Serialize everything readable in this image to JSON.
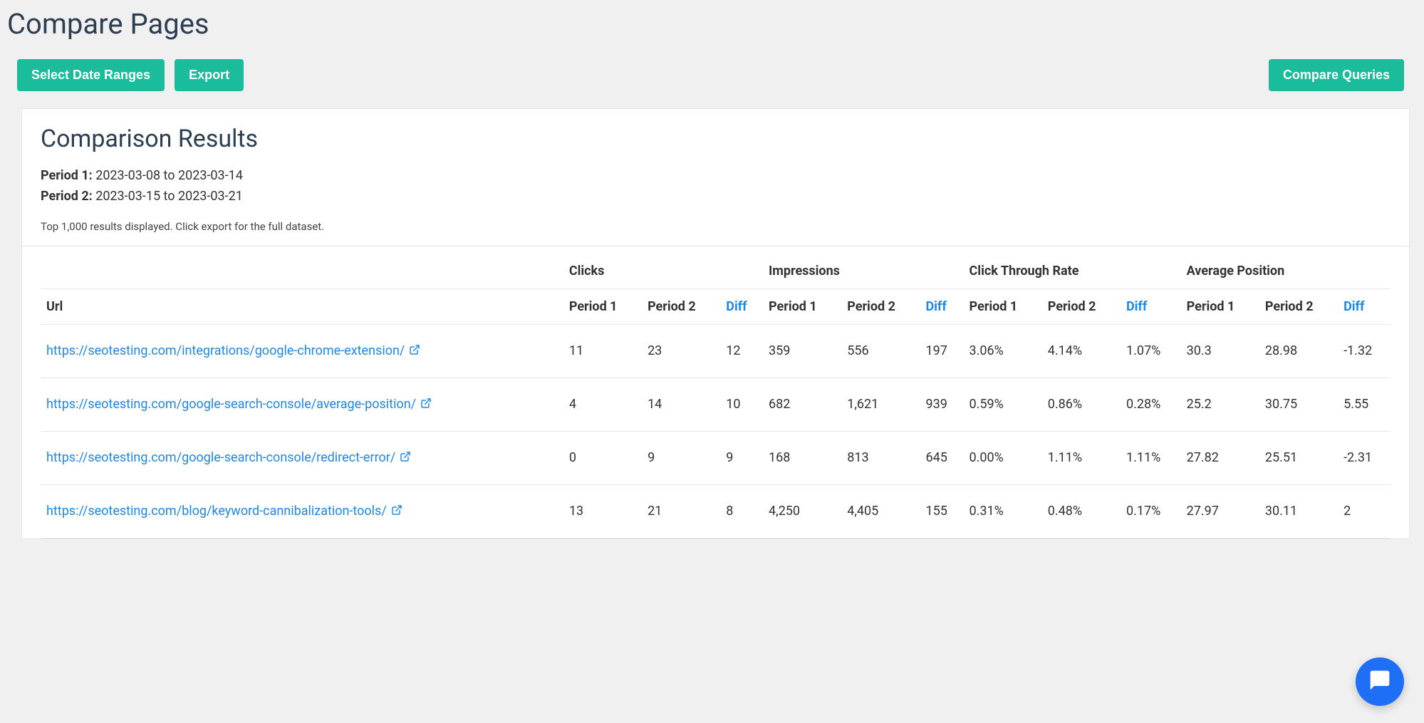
{
  "page": {
    "title": "Compare Pages"
  },
  "actions": {
    "select_date_ranges": "Select Date Ranges",
    "export": "Export",
    "compare_queries": "Compare Queries"
  },
  "results": {
    "title": "Comparison Results",
    "period1_label": "Period 1:",
    "period1_value": "2023-03-08 to 2023-03-14",
    "period2_label": "Period 2:",
    "period2_value": "2023-03-15 to 2023-03-21",
    "note": "Top 1,000 results displayed. Click export for the full dataset."
  },
  "table": {
    "columns": {
      "url": "Url",
      "group_clicks": "Clicks",
      "group_impressions": "Impressions",
      "group_ctr": "Click Through Rate",
      "group_position": "Average Position",
      "period1": "Period 1",
      "period2": "Period 2",
      "diff": "Diff"
    },
    "rows": [
      {
        "url": "https://seotesting.com/integrations/google-chrome-extension/",
        "clicks_p1": "11",
        "clicks_p2": "23",
        "clicks_diff": "12",
        "imp_p1": "359",
        "imp_p2": "556",
        "imp_diff": "197",
        "ctr_p1": "3.06%",
        "ctr_p2": "4.14%",
        "ctr_diff": "1.07%",
        "pos_p1": "30.3",
        "pos_p2": "28.98",
        "pos_diff": "-1.32"
      },
      {
        "url": "https://seotesting.com/google-search-console/average-position/",
        "clicks_p1": "4",
        "clicks_p2": "14",
        "clicks_diff": "10",
        "imp_p1": "682",
        "imp_p2": "1,621",
        "imp_diff": "939",
        "ctr_p1": "0.59%",
        "ctr_p2": "0.86%",
        "ctr_diff": "0.28%",
        "pos_p1": "25.2",
        "pos_p2": "30.75",
        "pos_diff": "5.55"
      },
      {
        "url": "https://seotesting.com/google-search-console/redirect-error/",
        "clicks_p1": "0",
        "clicks_p2": "9",
        "clicks_diff": "9",
        "imp_p1": "168",
        "imp_p2": "813",
        "imp_diff": "645",
        "ctr_p1": "0.00%",
        "ctr_p2": "1.11%",
        "ctr_diff": "1.11%",
        "pos_p1": "27.82",
        "pos_p2": "25.51",
        "pos_diff": "-2.31"
      },
      {
        "url": "https://seotesting.com/blog/keyword-cannibalization-tools/",
        "clicks_p1": "13",
        "clicks_p2": "21",
        "clicks_diff": "8",
        "imp_p1": "4,250",
        "imp_p2": "4,405",
        "imp_diff": "155",
        "ctr_p1": "0.31%",
        "ctr_p2": "0.48%",
        "ctr_diff": "0.17%",
        "pos_p1": "27.97",
        "pos_p2": "30.11",
        "pos_diff": "2"
      }
    ]
  }
}
